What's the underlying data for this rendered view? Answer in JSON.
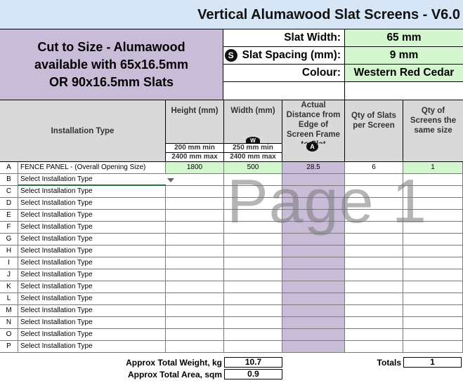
{
  "title": "Vertical Alumawood Slat Screens - V6.0",
  "promo": {
    "line1": "Cut to Size - Alumawood",
    "line2": "available with 65x16.5mm",
    "line3": "OR 90x16.5mm Slats"
  },
  "settings": {
    "slat_width_label": "Slat Width:",
    "slat_width_value": "65 mm",
    "slat_spacing_badge": "S",
    "slat_spacing_label": "Slat Spacing (mm):",
    "slat_spacing_value": "9 mm",
    "colour_label": "Colour:",
    "colour_value": "Western Red Cedar"
  },
  "headers": {
    "installation_type": "Installation Type",
    "height": "Height (mm)",
    "height_min": "200 mm min",
    "height_max": "2400 mm max",
    "width": "Width (mm)",
    "width_badge": "W",
    "width_min": "250 mm min",
    "width_max": "2400 mm max",
    "distance": "Actual Distance from Edge of Screen Frame to Slat",
    "distance_badge": "A",
    "qty_slats": "Qty of Slats per Screen",
    "qty_screens": "Qty of Screens the same size"
  },
  "rows": [
    {
      "letter": "A",
      "type": "FENCE PANEL - (Overall Opening Size)",
      "height": "1800",
      "width": "500",
      "distance": "28.5",
      "qty_slats": "6",
      "qty_screens": "1"
    },
    {
      "letter": "B",
      "type": "Select Installation Type"
    },
    {
      "letter": "C",
      "type": "Select Installation Type"
    },
    {
      "letter": "D",
      "type": "Select Installation Type"
    },
    {
      "letter": "E",
      "type": "Select Installation Type"
    },
    {
      "letter": "F",
      "type": "Select Installation Type"
    },
    {
      "letter": "G",
      "type": "Select Installation Type"
    },
    {
      "letter": "H",
      "type": "Select Installation Type"
    },
    {
      "letter": "I",
      "type": "Select Installation Type"
    },
    {
      "letter": "J",
      "type": "Select Installation Type"
    },
    {
      "letter": "K",
      "type": "Select Installation Type"
    },
    {
      "letter": "L",
      "type": "Select Installation Type"
    },
    {
      "letter": "M",
      "type": "Select Installation Type"
    },
    {
      "letter": "N",
      "type": "Select Installation Type"
    },
    {
      "letter": "O",
      "type": "Select Installation Type"
    },
    {
      "letter": "P",
      "type": "Select Installation Type"
    }
  ],
  "watermark": "Page 1",
  "totals": {
    "weight_label": "Approx Total Weight, kg",
    "weight_value": "10.7",
    "area_label": "Approx Total Area, sqm",
    "area_value": "0.9",
    "totals_label": "Totals",
    "totals_value": "1"
  },
  "colors": {
    "title_bg": "#d6e6f6",
    "promo_bg": "#c9bcd8",
    "input_green": "#d4f6cf",
    "header_gray": "#d9d9d9"
  }
}
